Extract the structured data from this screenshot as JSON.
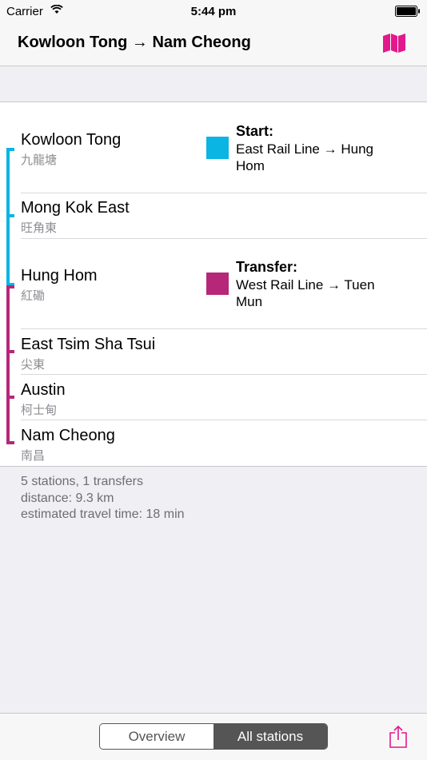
{
  "status_bar": {
    "carrier": "Carrier",
    "time": "5:44 pm"
  },
  "nav": {
    "title": "Kowloon Tong → Nam Cheong"
  },
  "colors": {
    "east_rail": "#0ab4e3",
    "west_rail": "#b6277a",
    "accent": "#e2198c"
  },
  "stations": [
    {
      "name": "Kowloon Tong",
      "chinese": "九龍塘"
    },
    {
      "name": "Mong Kok East",
      "chinese": "旺角東"
    },
    {
      "name": "Hung Hom",
      "chinese": "紅磡"
    },
    {
      "name": "East Tsim Sha Tsui",
      "chinese": "尖東"
    },
    {
      "name": "Austin",
      "chinese": "柯士甸"
    },
    {
      "name": "Nam Cheong",
      "chinese": "南昌"
    }
  ],
  "info": {
    "start": {
      "heading": "Start:",
      "text": "East Rail Line → Hung Hom"
    },
    "transfer": {
      "heading": "Transfer:",
      "text": "West Rail Line → Tuen Mun"
    }
  },
  "summary": {
    "stations": "5 stations, 1 transfers",
    "distance": "distance: 9.3 km",
    "time": "estimated travel time: 18 min"
  },
  "toolbar": {
    "overview": "Overview",
    "all_stations": "All stations"
  }
}
